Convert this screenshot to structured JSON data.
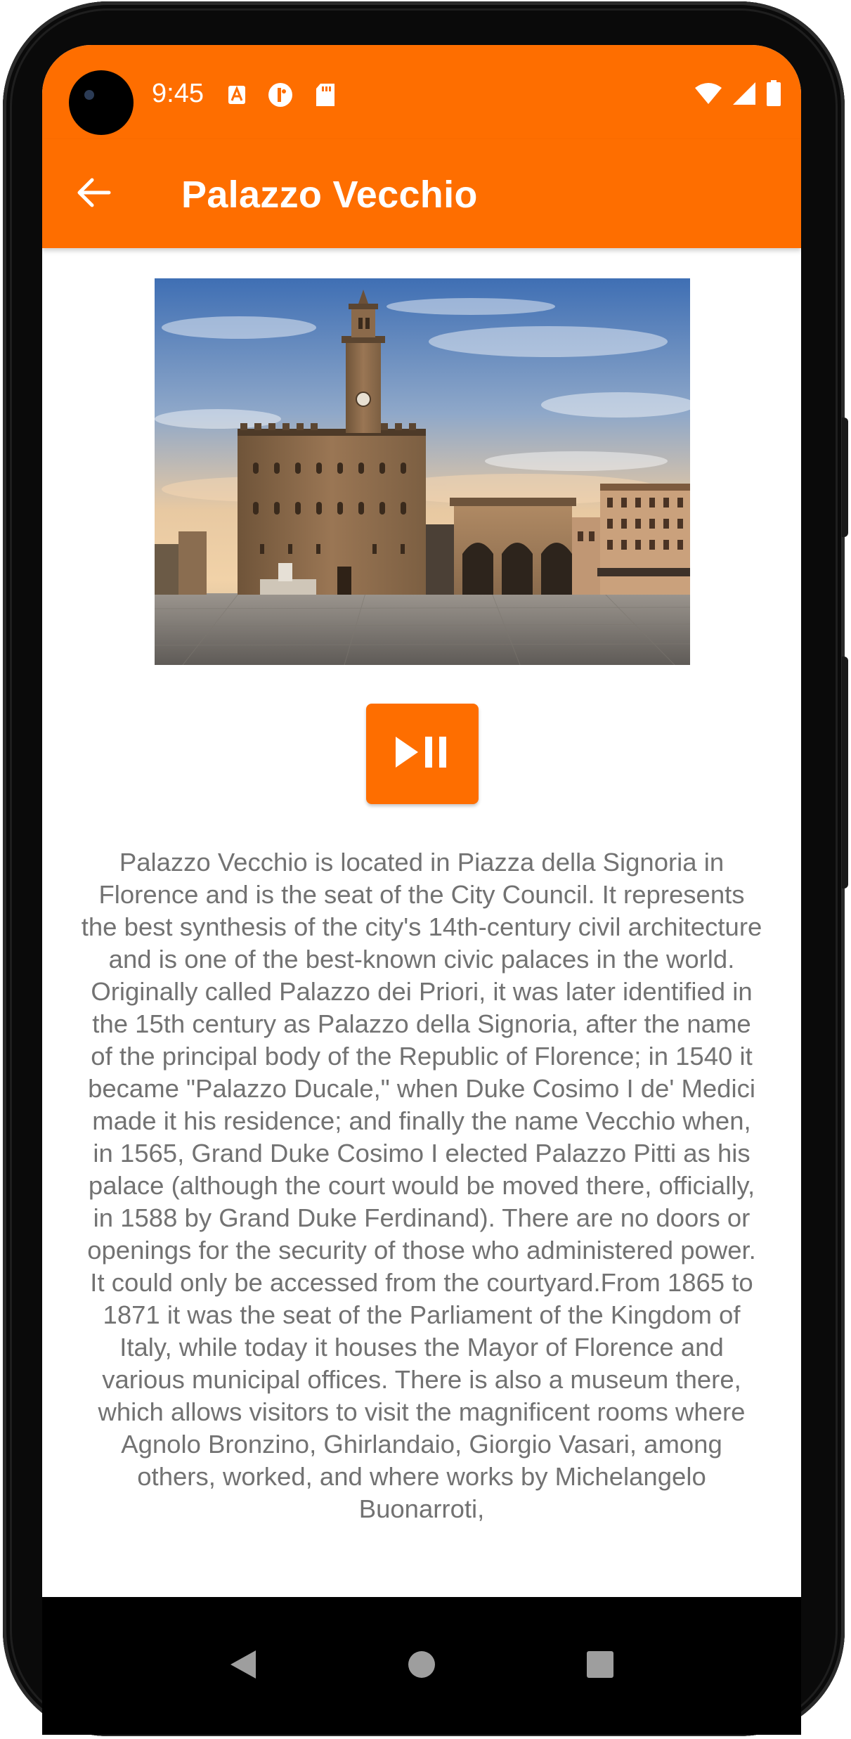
{
  "status_bar": {
    "time": "9:45",
    "left_icons": [
      "font-a-icon",
      "ring-icon",
      "sd-card-icon"
    ],
    "right_icons": [
      "wifi-icon",
      "signal-icon",
      "battery-icon"
    ],
    "background": "#fe6e00"
  },
  "app_bar": {
    "title": "Palazzo Vecchio",
    "back_icon": "arrow-left-icon",
    "background": "#fe6e00"
  },
  "hero_image": {
    "subject": "Palazzo Vecchio, Piazza della Signoria, Florence"
  },
  "audio_control": {
    "icon": "play-pause-icon",
    "color": "#fe6e00"
  },
  "description": {
    "text": "Palazzo Vecchio is located in Piazza della Signoria in Florence and is the seat of the City Council. It represents the best synthesis of the city's 14th-century civil architecture and is one of the best-known civic palaces in the world. Originally called Palazzo dei Priori, it was later identified in the 15th century as Palazzo della Signoria, after the name of the principal body of the Republic of Florence; in 1540 it became \"Palazzo Ducale,\" when Duke Cosimo I de' Medici made it his residence; and finally the name Vecchio when, in 1565, Grand Duke Cosimo I elected Palazzo Pitti as his palace (although the court would be moved there, officially, in 1588 by Grand Duke Ferdinand). There are no doors or openings for the security of those who administered power. It could only be accessed from the courtyard.From 1865 to 1871 it was the seat of the Parliament of the Kingdom of Italy, while today it houses the Mayor of Florence and various municipal offices. There is also a museum there, which allows visitors to visit the magnificent rooms where Agnolo Bronzino, Ghirlandaio, Giorgio Vasari, among others, worked, and where works by Michelangelo Buonarroti,"
  },
  "nav_bar": {
    "icons": [
      "back-triangle-icon",
      "home-circle-icon",
      "recents-square-icon"
    ]
  }
}
